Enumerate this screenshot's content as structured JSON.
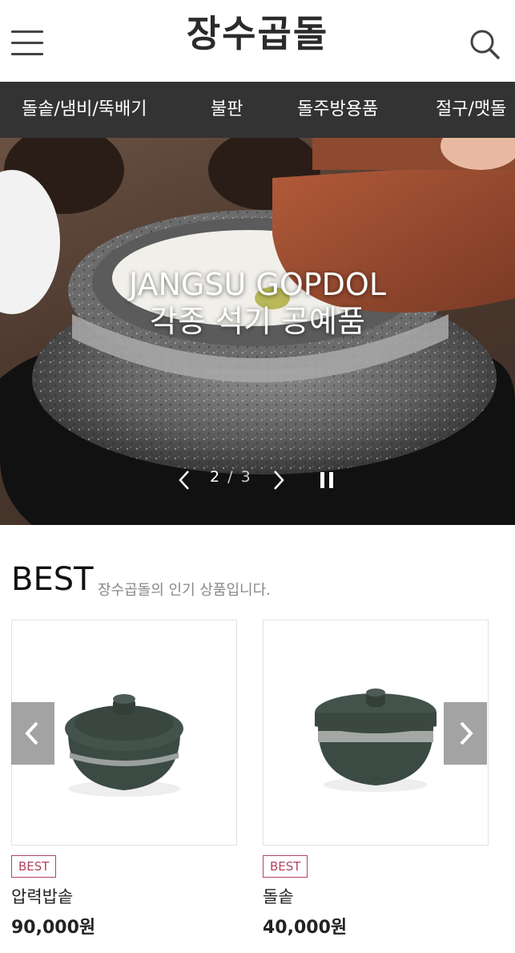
{
  "header": {
    "logo": "장수곱돌",
    "menu_icon": "hamburger-menu-icon",
    "search_icon": "search-icon"
  },
  "categories": [
    {
      "label": "돌솥/냄비/뚝배기"
    },
    {
      "label": "불판"
    },
    {
      "label": "돌주방용품"
    },
    {
      "label": "절구/맷돌"
    }
  ],
  "hero": {
    "line1": "JANGSU GOPDOL",
    "line2": "각종 석기 공예품",
    "current": "2",
    "separator": "/",
    "total": "3"
  },
  "best": {
    "title": "BEST",
    "subtitle": "장수곱돌의 인기 상품입니다.",
    "products": [
      {
        "badge": "BEST",
        "name": "압력밥솥",
        "price": "90,000원"
      },
      {
        "badge": "BEST",
        "name": "돌솥",
        "price": "40,000원"
      }
    ]
  },
  "colors": {
    "nav_bg": "#333333",
    "badge": "#b0455f",
    "stone": "#3c4a44"
  }
}
